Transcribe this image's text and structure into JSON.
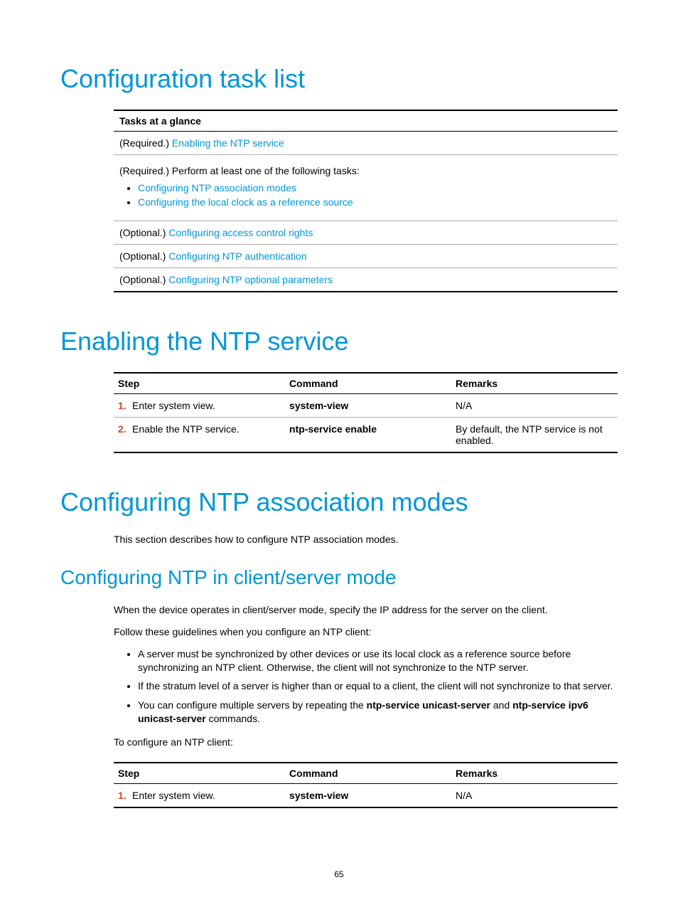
{
  "h1_config_task_list": "Configuration task list",
  "tasks_header": "Tasks at a glance",
  "req_label": "(Required.)",
  "opt_label": "(Optional.)",
  "task1_link": "Enabling the NTP service",
  "task2_intro": "(Required.) Perform at least one of the following tasks:",
  "task2_link1": "Configuring NTP association modes",
  "task2_link2": "Configuring the local clock as a reference source",
  "task3_link": "Configuring access control rights",
  "task4_link": "Configuring NTP authentication",
  "task5_link": "Configuring NTP optional parameters",
  "h1_enabling": "Enabling the NTP service",
  "col_step": "Step",
  "col_command": "Command",
  "col_remarks": "Remarks",
  "enable_steps": {
    "r1": {
      "num": "1.",
      "step": "Enter system view.",
      "cmd": "system-view",
      "rem": "N/A"
    },
    "r2": {
      "num": "2.",
      "step": "Enable the NTP service.",
      "cmd": "ntp-service enable",
      "rem": "By default, the NTP service is not enabled."
    }
  },
  "h1_assoc": "Configuring NTP association modes",
  "assoc_intro": "This section describes how to configure NTP association modes.",
  "h2_client_server": "Configuring NTP in client/server mode",
  "cs_p1": "When the device operates in client/server mode, specify the IP address for the server on the client.",
  "cs_p2": "Follow these guidelines when you configure an NTP client:",
  "cs_b1": "A server must be synchronized by other devices or use its local clock as a reference source before synchronizing an NTP client. Otherwise, the client will not synchronize to the NTP server.",
  "cs_b2": "If the stratum level of a server is higher than or equal to a client, the client will not synchronize to that server.",
  "cs_b3_pre": "You can configure multiple servers by repeating the ",
  "cs_b3_cmd1": "ntp-service unicast-server",
  "cs_b3_mid": " and ",
  "cs_b3_cmd2": "ntp-service ipv6 unicast-server",
  "cs_b3_post": " commands.",
  "cs_p3": "To configure an NTP client:",
  "client_steps": {
    "r1": {
      "num": "1.",
      "step": "Enter system view.",
      "cmd": "system-view",
      "rem": "N/A"
    }
  },
  "page_number": "65"
}
